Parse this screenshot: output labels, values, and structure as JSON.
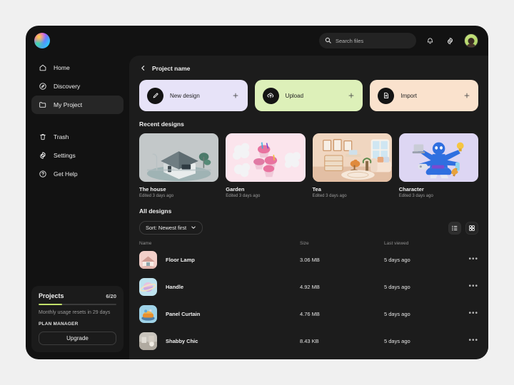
{
  "brand": {
    "logo_icon": "gradient-circle-logo"
  },
  "topbar": {
    "search": {
      "placeholder": "Search files",
      "value": "",
      "icon": "search-icon"
    },
    "notifications_icon": "bell-icon",
    "settings_icon": "gear-icon",
    "avatar_icon": "user-avatar"
  },
  "sidebar": {
    "items": [
      {
        "label": "Home",
        "icon": "home-icon",
        "active": false
      },
      {
        "label": "Discovery",
        "icon": "compass-icon",
        "active": false
      },
      {
        "label": "My Project",
        "icon": "folder-icon",
        "active": true
      }
    ],
    "items_secondary": [
      {
        "label": "Trash",
        "icon": "trash-icon"
      },
      {
        "label": "Settings",
        "icon": "gear-icon"
      },
      {
        "label": "Get Help",
        "icon": "help-circle-icon"
      }
    ],
    "plan": {
      "title": "Projects",
      "count": "6/20",
      "progress_percent": 30,
      "reset_text": "Monthly usage resets in 29 days",
      "manager_label": "PLAN MANAGER",
      "upgrade_label": "Upgrade",
      "progress_color": "#c2e06a"
    }
  },
  "main": {
    "breadcrumb": {
      "back_icon": "chevron-left-icon",
      "title": "Project name"
    },
    "actions": [
      {
        "label": "New design",
        "icon": "pen-icon",
        "plus_icon": "plus-icon",
        "color": "#e7e3f8",
        "dotted": false
      },
      {
        "label": "Upload",
        "icon": "cloud-upload-icon",
        "plus_icon": "plus-icon",
        "color": "#ddf0b9",
        "dotted": true
      },
      {
        "label": "Import",
        "icon": "file-import-icon",
        "plus_icon": "plus-icon",
        "color": "#fae2cd",
        "dotted": false
      }
    ],
    "recent": {
      "title": "Recent designs",
      "items": [
        {
          "name": "The house",
          "meta": "Edited 3 days ago",
          "thumb": "isometric-house"
        },
        {
          "name": "Garden",
          "meta": "Edited 3 days ago",
          "thumb": "pink-cupcakes"
        },
        {
          "name": "Tea",
          "meta": "Edited 3 days ago",
          "thumb": "living-room"
        },
        {
          "name": "Character",
          "meta": "Edited 3 days ago",
          "thumb": "blue-character"
        }
      ]
    },
    "all": {
      "title": "All designs",
      "sort_label": "Sort: Newest first",
      "sort_caret_icon": "chevron-down-icon",
      "view_list_icon": "list-view-icon",
      "view_grid_icon": "grid-view-icon",
      "columns": {
        "name": "Name",
        "size": "Size",
        "viewed": "Last viewed"
      },
      "rows": [
        {
          "name": "Floor Lamp",
          "size": "3.06 MB",
          "viewed": "5 days ago",
          "thumb": "pink-house",
          "menu_icon": "more-options-icon"
        },
        {
          "name": "Handle",
          "size": "4.92 MB",
          "viewed": "5 days ago",
          "thumb": "planet-sphere",
          "menu_icon": "more-options-icon"
        },
        {
          "name": "Panel Curtain",
          "size": "4.76 MB",
          "viewed": "5 days ago",
          "thumb": "orange-object",
          "menu_icon": "more-options-icon"
        },
        {
          "name": "Shabby Chic",
          "size": "8.43 KB",
          "viewed": "5 days ago",
          "thumb": "shabby-scene",
          "menu_icon": "more-options-icon"
        }
      ]
    }
  }
}
